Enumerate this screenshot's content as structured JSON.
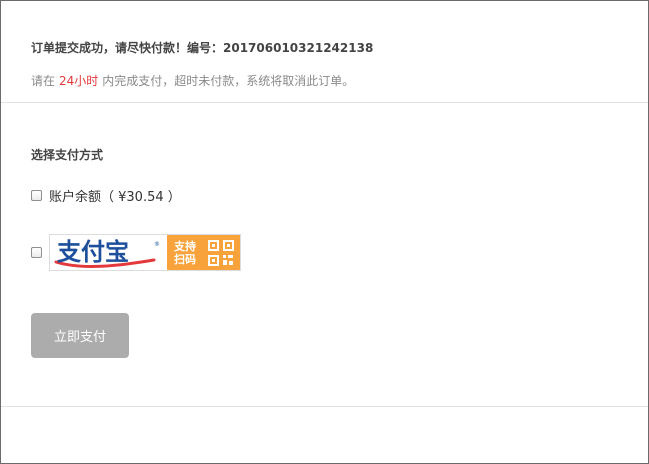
{
  "order": {
    "success_text": "订单提交成功，请尽快付款！编号：201706010321242138",
    "notice_prefix": "请在",
    "notice_highlight": "24小时",
    "notice_suffix": "内完成支付，超时未付款，系统将取消此订单。"
  },
  "payment": {
    "section_title": "选择支付方式",
    "balance_label": "账户余额（ ¥30.54 ）",
    "alipay": {
      "logo_text": "支付宝",
      "scan_line1": "支持",
      "scan_line2": "扫码",
      "icon": "qr-code-icon"
    }
  },
  "actions": {
    "pay_now_label": "立即支付"
  },
  "colors": {
    "highlight": "#e4393c",
    "alipay_blue": "#1d4f9c",
    "alipay_orange": "#f7a23a",
    "button_gray": "#acacac"
  }
}
